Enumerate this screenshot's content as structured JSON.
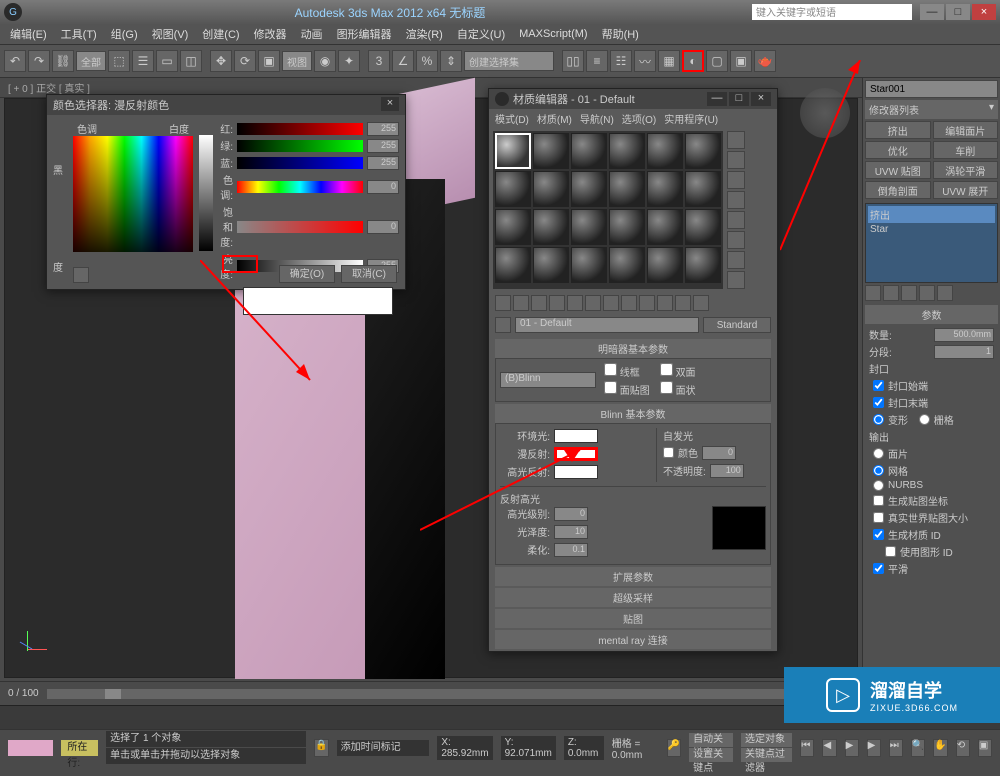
{
  "app": {
    "title": "Autodesk 3ds Max 2012 x64   无标题",
    "search_placeholder": "键入关键字或短语"
  },
  "menu": [
    "编辑(E)",
    "工具(T)",
    "组(G)",
    "视图(V)",
    "创建(C)",
    "修改器",
    "动画",
    "图形编辑器",
    "渲染(R)",
    "自定义(U)",
    "MAXScript(M)",
    "帮助(H)"
  ],
  "toolbar": {
    "selset_combo": "全部",
    "view_combo": "视图",
    "selection_combo": "创建选择集"
  },
  "viewport_label": "[ + 0 ] 正交 [ 真实 ]",
  "colorpicker": {
    "title": "颜色选择器: 漫反射颜色",
    "labels": {
      "hue": "色调",
      "whiteness": "白度",
      "black": "黑",
      "degree": "度"
    },
    "channels": {
      "r": {
        "label": "红:",
        "value": 255
      },
      "g": {
        "label": "绿:",
        "value": 255
      },
      "b": {
        "label": "蓝:",
        "value": 255
      },
      "h": {
        "label": "色调:",
        "value": 0
      },
      "s": {
        "label": "饱和度:",
        "value": 0
      },
      "v": {
        "label": "亮度:",
        "value": 255
      }
    },
    "ok": "确定(O)",
    "cancel": "取消(C)"
  },
  "material_editor": {
    "title": "材质编辑器 - 01 - Default",
    "menu": [
      "模式(D)",
      "材质(M)",
      "导航(N)",
      "选项(O)",
      "实用程序(U)"
    ],
    "name": "01 - Default",
    "standard_btn": "Standard",
    "shader_rollout": "明暗器基本参数",
    "shader_combo": "(B)Blinn",
    "wire": "线框",
    "two_sided": "双面",
    "face_map": "面贴图",
    "faceted": "面状",
    "blinn_rollout": "Blinn 基本参数",
    "ambient": "环境光:",
    "diffuse": "漫反射:",
    "specular": "高光反射:",
    "self_illum": "自发光",
    "color_chk": "颜色",
    "self_illum_val": 0,
    "opacity": "不透明度:",
    "opacity_val": 100,
    "spec_section": "反射高光",
    "spec_level": "高光级别:",
    "spec_level_val": 0,
    "glossiness": "光泽度:",
    "glossiness_val": 10,
    "soften": "柔化:",
    "soften_val": 0.1,
    "rollouts": [
      "扩展参数",
      "超级采样",
      "贴图",
      "mental ray 连接"
    ]
  },
  "cmdpanel": {
    "object_name": "Star001",
    "modifier_list": "修改器列表",
    "buttons": [
      "挤出",
      "编辑面片",
      "优化",
      "车削",
      "UVW 贴图",
      "涡轮平滑",
      "倒角剖面",
      "UVW 展开"
    ],
    "stack": [
      "挤出",
      "Star"
    ],
    "params_head": "参数",
    "amount": {
      "label": "数量:",
      "value": "500.0mm"
    },
    "segments": {
      "label": "分段:",
      "value": "1"
    },
    "cap_section": "封口",
    "cap_start": "封口始端",
    "cap_end": "封口末端",
    "morph": "变形",
    "grid": "栅格",
    "output_section": "输出",
    "output": [
      "面片",
      "网格",
      "NURBS"
    ],
    "gen_map": "生成贴图坐标",
    "real_world": "真实世界贴图大小",
    "gen_mat": "生成材质 ID",
    "use_shape": "使用图形 ID",
    "smooth": "平滑"
  },
  "timeline": {
    "range": "0 / 100"
  },
  "status": {
    "selected": "选择了 1 个对象",
    "hint": "单击或单击并拖动以选择对象",
    "x": "X: 285.92mm",
    "y": "Y: 92.071mm",
    "z": "Z: 0.0mm",
    "grid": "栅格 = 0.0mm",
    "autokey": "自动关键点",
    "selkey": "选定对象",
    "setkey": "设置关键点",
    "keyfilter": "关键点过滤器",
    "addtime": "添加时间标记",
    "now": "所在行:"
  },
  "watermark": {
    "big": "溜溜自学",
    "small": "ZIXUE.3D66.COM"
  }
}
